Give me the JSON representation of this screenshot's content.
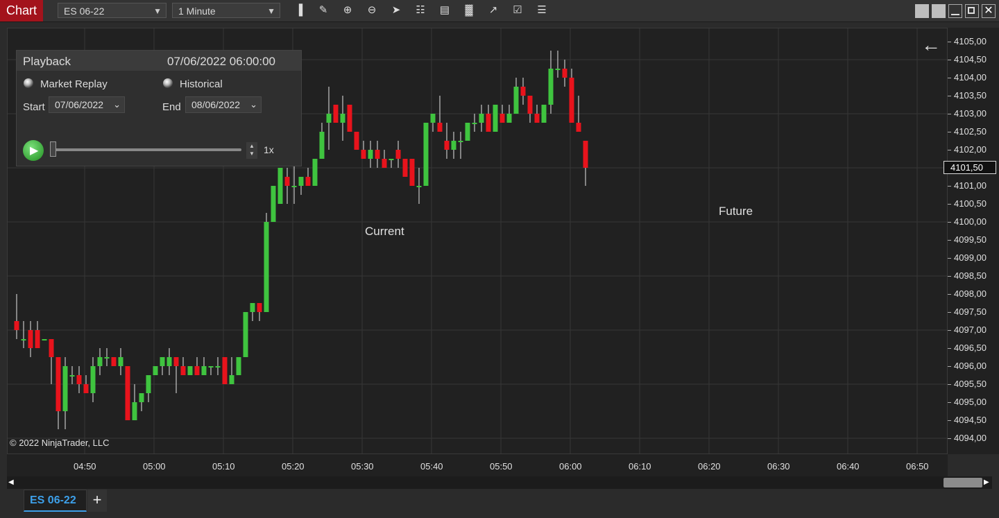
{
  "window": {
    "title": "Chart"
  },
  "toolbar": {
    "instrument": "ES 06-22",
    "interval": "1 Minute",
    "tools": [
      "bar-chart-icon",
      "pencil-icon",
      "zoom-in-icon",
      "zoom-out-icon",
      "cursor-icon",
      "data-box-icon",
      "properties-icon",
      "strategies-icon",
      "indicators-icon",
      "templates-icon",
      "list-icon"
    ]
  },
  "playback": {
    "title": "Playback",
    "datetime": "07/06/2022 06:00:00",
    "mode_replay": "Market Replay",
    "mode_historical": "Historical",
    "start_label": "Start",
    "start_value": "07/06/2022",
    "end_label": "End",
    "end_value": "08/06/2022",
    "speed": "1x"
  },
  "chart": {
    "current_label": "Current",
    "future_label": "Future",
    "copyright": "© 2022 NinjaTrader, LLC",
    "last_price": "4101,50"
  },
  "chart_data": {
    "type": "candlestick",
    "y_ticks": [
      "4105,00",
      "4104,50",
      "4104,00",
      "4103,50",
      "4103,00",
      "4102,50",
      "4102,00",
      "4101,50",
      "4101,00",
      "4100,50",
      "4100,00",
      "4099,50",
      "4099,00",
      "4098,50",
      "4098,00",
      "4097,50",
      "4097,00",
      "4096,50",
      "4096,00",
      "4095,50",
      "4095,00",
      "4094,50",
      "4094,00"
    ],
    "x_ticks": [
      "04:50",
      "05:00",
      "05:10",
      "05:20",
      "05:30",
      "05:40",
      "05:50",
      "06:00",
      "06:10",
      "06:20",
      "06:30",
      "06:40",
      "06:50"
    ],
    "up_color": "#3fc43f",
    "down_color": "#e8131c",
    "ohlc": [
      [
        4097.25,
        4098.0,
        4096.75,
        4097.0
      ],
      [
        4096.75,
        4097.25,
        4096.5,
        4096.75
      ],
      [
        4097.0,
        4097.25,
        4096.25,
        4096.5
      ],
      [
        4097.0,
        4097.25,
        4096.5,
        4096.5
      ],
      [
        4096.75,
        4096.75,
        4096.75,
        4096.75
      ],
      [
        4096.75,
        4096.75,
        4095.5,
        4096.25
      ],
      [
        4096.25,
        4096.25,
        4094.25,
        4094.75
      ],
      [
        4094.75,
        4096.25,
        4094.25,
        4096.0
      ],
      [
        4095.75,
        4096.0,
        4095.5,
        4095.75
      ],
      [
        4095.75,
        4096.0,
        4095.25,
        4095.5
      ],
      [
        4095.5,
        4095.75,
        4095.25,
        4095.25
      ],
      [
        4095.25,
        4096.25,
        4095.0,
        4096.0
      ],
      [
        4096.0,
        4096.5,
        4095.75,
        4096.25
      ],
      [
        4096.25,
        4096.5,
        4096.0,
        4096.25
      ],
      [
        4096.25,
        4096.25,
        4096.0,
        4096.0
      ],
      [
        4096.0,
        4096.5,
        4095.75,
        4096.25
      ],
      [
        4096.0,
        4096.0,
        4094.5,
        4094.5
      ],
      [
        4094.5,
        4095.5,
        4094.5,
        4095.0
      ],
      [
        4095.0,
        4095.25,
        4094.75,
        4095.25
      ],
      [
        4095.25,
        4095.75,
        4095.0,
        4095.75
      ],
      [
        4095.75,
        4096.0,
        4095.75,
        4096.0
      ],
      [
        4096.0,
        4096.25,
        4095.75,
        4096.25
      ],
      [
        4096.0,
        4096.5,
        4095.75,
        4096.25
      ],
      [
        4096.25,
        4096.25,
        4095.25,
        4096.0
      ],
      [
        4096.0,
        4096.25,
        4095.75,
        4095.75
      ],
      [
        4095.75,
        4096.0,
        4095.75,
        4096.0
      ],
      [
        4096.0,
        4096.25,
        4095.75,
        4095.75
      ],
      [
        4095.75,
        4096.25,
        4095.75,
        4096.0
      ],
      [
        4096.0,
        4096.0,
        4095.75,
        4096.0
      ],
      [
        4096.0,
        4096.25,
        4095.75,
        4096.0
      ],
      [
        4096.25,
        4096.25,
        4095.5,
        4095.5
      ],
      [
        4095.5,
        4096.25,
        4095.5,
        4095.75
      ],
      [
        4095.75,
        4096.25,
        4095.75,
        4096.25
      ],
      [
        4096.25,
        4097.5,
        4096.25,
        4097.5
      ],
      [
        4097.5,
        4097.75,
        4097.25,
        4097.75
      ],
      [
        4097.75,
        4097.75,
        4097.25,
        4097.5
      ],
      [
        4097.5,
        4100.25,
        4097.5,
        4100.0
      ],
      [
        4100.0,
        4100.75,
        4100.0,
        4101.0
      ],
      [
        4100.5,
        4101.5,
        4100.5,
        4101.5
      ],
      [
        4101.25,
        4101.5,
        4100.5,
        4101.0
      ],
      [
        4101.0,
        4101.75,
        4100.5,
        4101.0
      ],
      [
        4101.0,
        4101.25,
        4100.75,
        4101.25
      ],
      [
        4101.25,
        4101.5,
        4101.0,
        4101.0
      ],
      [
        4101.0,
        4101.75,
        4101.0,
        4101.75
      ],
      [
        4101.75,
        4102.75,
        4101.75,
        4102.5
      ],
      [
        4102.75,
        4103.75,
        4102.0,
        4103.0
      ],
      [
        4103.25,
        4103.25,
        4102.75,
        4102.75
      ],
      [
        4102.75,
        4103.5,
        4102.25,
        4103.0
      ],
      [
        4103.25,
        4103.25,
        4102.5,
        4102.5
      ],
      [
        4102.5,
        4102.5,
        4102.0,
        4102.0
      ],
      [
        4102.0,
        4102.25,
        4101.75,
        4101.75
      ],
      [
        4101.75,
        4102.25,
        4101.5,
        4102.0
      ],
      [
        4102.0,
        4102.25,
        4101.5,
        4101.75
      ],
      [
        4101.75,
        4102.0,
        4101.5,
        4101.5
      ],
      [
        4101.75,
        4101.75,
        4101.5,
        4101.75
      ],
      [
        4102.0,
        4102.25,
        4101.5,
        4101.75
      ],
      [
        4101.75,
        4101.75,
        4101.25,
        4101.25
      ],
      [
        4101.75,
        4101.75,
        4101.0,
        4101.0
      ],
      [
        4101.0,
        4101.5,
        4100.5,
        4101.0
      ],
      [
        4101.0,
        4102.75,
        4101.0,
        4102.75
      ],
      [
        4102.75,
        4103.0,
        4102.5,
        4103.0
      ],
      [
        4102.75,
        4103.5,
        4102.5,
        4102.5
      ],
      [
        4102.25,
        4102.75,
        4101.75,
        4102.0
      ],
      [
        4102.0,
        4102.5,
        4101.75,
        4102.25
      ],
      [
        4102.25,
        4102.5,
        4101.75,
        4102.25
      ],
      [
        4102.25,
        4102.75,
        4102.25,
        4102.75
      ],
      [
        4102.75,
        4103.0,
        4102.5,
        4102.75
      ],
      [
        4102.75,
        4103.25,
        4102.5,
        4103.0
      ],
      [
        4103.0,
        4103.25,
        4102.5,
        4102.5
      ],
      [
        4102.5,
        4103.25,
        4102.5,
        4103.25
      ],
      [
        4103.0,
        4103.25,
        4102.75,
        4102.75
      ],
      [
        4102.75,
        4103.25,
        4102.75,
        4103.0
      ],
      [
        4103.0,
        4104.0,
        4103.0,
        4103.75
      ],
      [
        4103.75,
        4104.0,
        4103.25,
        4103.5
      ],
      [
        4103.5,
        4103.5,
        4102.75,
        4103.0
      ],
      [
        4103.0,
        4103.25,
        4102.75,
        4102.75
      ],
      [
        4102.75,
        4103.25,
        4102.75,
        4103.25
      ],
      [
        4103.25,
        4104.75,
        4103.0,
        4104.25
      ],
      [
        4104.25,
        4104.75,
        4104.0,
        4104.25
      ],
      [
        4104.25,
        4104.5,
        4103.75,
        4104.0
      ],
      [
        4104.0,
        4104.25,
        4102.75,
        4102.75
      ],
      [
        4102.75,
        4103.5,
        4102.5,
        4102.5
      ],
      [
        4102.25,
        4102.25,
        4101.0,
        4101.5
      ]
    ]
  },
  "time_axis": {
    "scroll_left": "◀",
    "scroll_right": "▶"
  },
  "tabs": [
    {
      "label": "ES 06-22"
    }
  ],
  "add_tab": "+",
  "colors": {
    "accent": "#a3131c",
    "tab_text": "#3da0ea"
  }
}
